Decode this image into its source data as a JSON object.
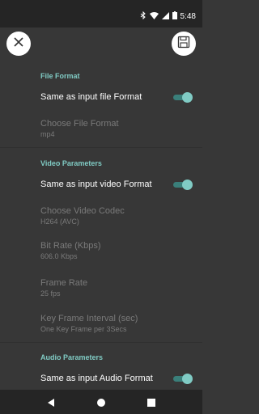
{
  "status": {
    "time": "5:48"
  },
  "icons": {
    "close": "close-icon",
    "save": "save-icon",
    "bluetooth": "bluetooth-icon",
    "wifi": "wifi-icon",
    "signal": "signal-icon",
    "battery": "battery-icon"
  },
  "file_format": {
    "header": "File Format",
    "same_as_input_label": "Same as input file Format",
    "same_as_input_on": true,
    "choose_label": "Choose File Format",
    "choose_value": "mp4"
  },
  "video": {
    "header": "Video Parameters",
    "same_as_input_label": "Same as input video Format",
    "same_as_input_on": true,
    "codec_label": "Choose Video Codec",
    "codec_value": "H264 (AVC)",
    "bitrate_label": "Bit Rate (Kbps)",
    "bitrate_value": "606.0 Kbps",
    "framerate_label": "Frame Rate",
    "framerate_value": "25 fps",
    "keyframe_label": "Key Frame Interval (sec)",
    "keyframe_value": "One Key Frame per 3Secs"
  },
  "audio": {
    "header": "Audio Parameters",
    "same_as_input_label": "Same as input Audio Format",
    "same_as_input_on": true
  },
  "colors": {
    "accent": "#80cbc4",
    "background": "#373737"
  }
}
